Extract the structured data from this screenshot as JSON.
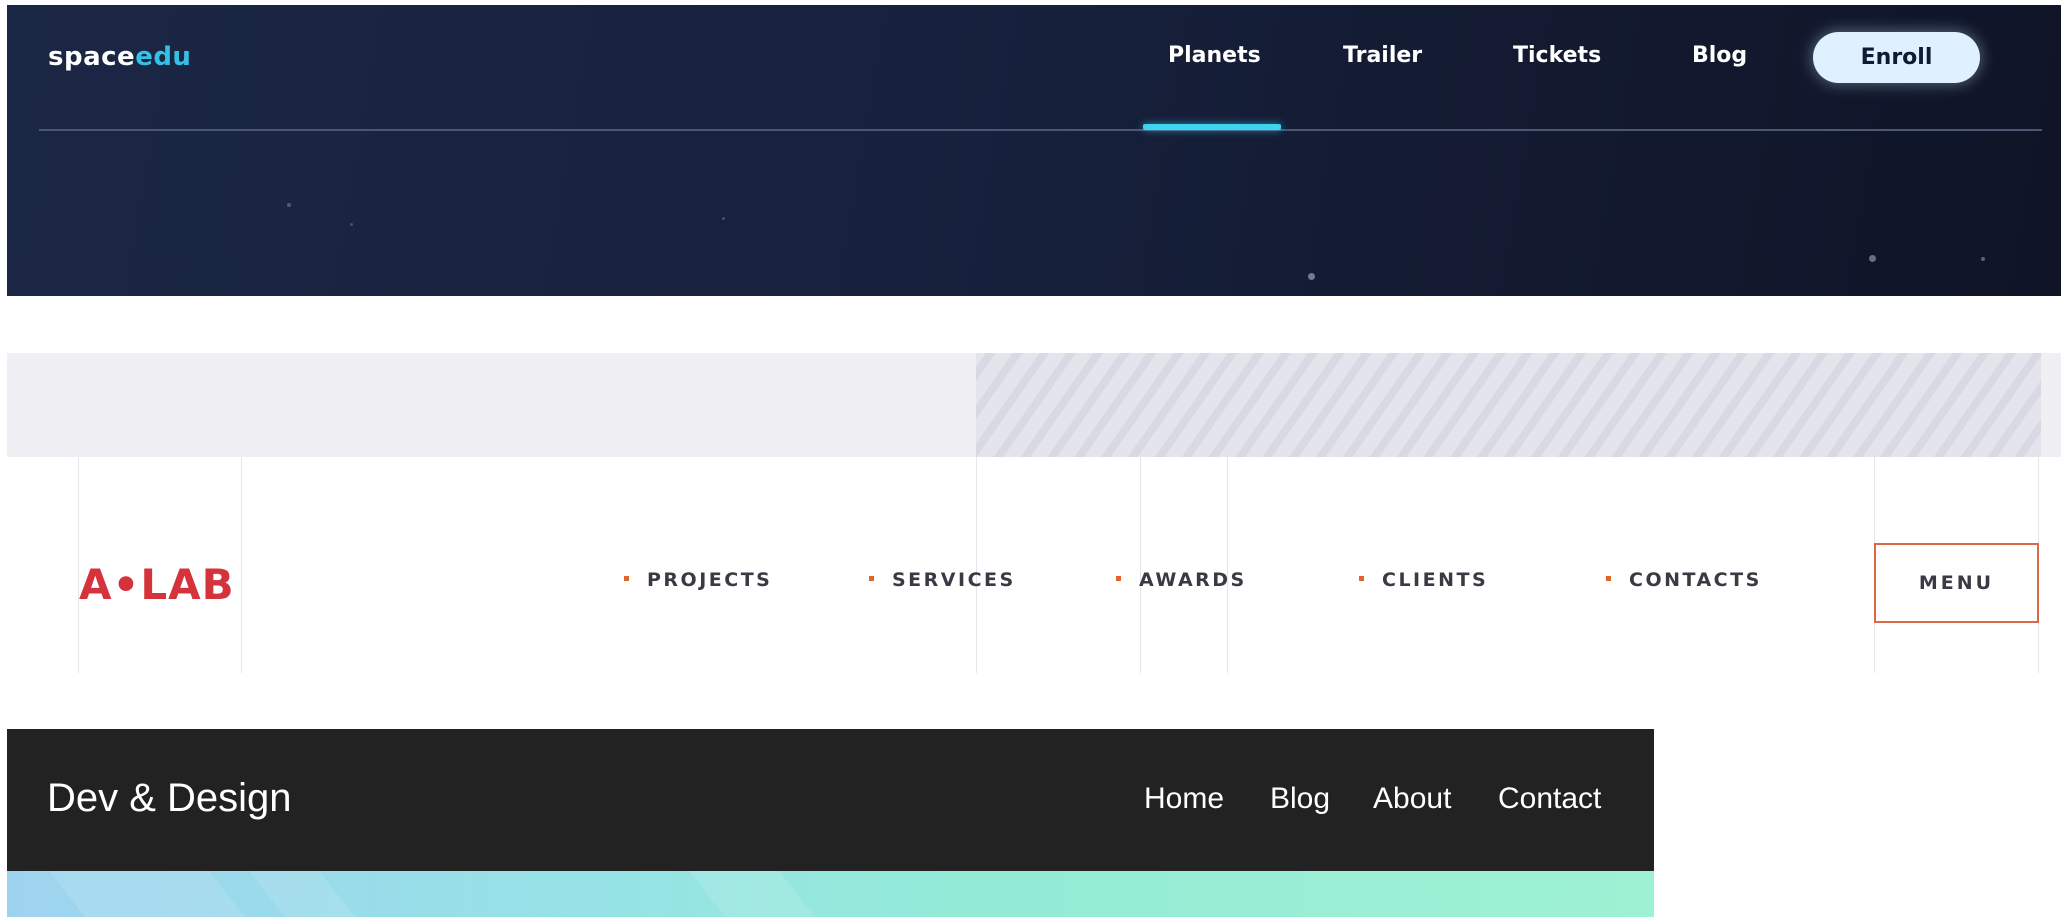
{
  "spaceedu": {
    "logo_main": "space",
    "logo_accent": "edu",
    "nav": {
      "planets": "Planets",
      "trailer": "Trailer",
      "tickets": "Tickets",
      "blog": "Blog"
    },
    "active_item": "Planets",
    "enroll_label": "Enroll",
    "colors": {
      "background": "#17213d",
      "accent": "#3fd3f2",
      "button": "#dff0ff"
    }
  },
  "alab": {
    "logo": "A•LAB",
    "nav": {
      "projects": "PROJECTS",
      "services": "SERVICES",
      "awards": "AWARDS",
      "clients": "CLIENTS",
      "contacts": "CONTACTS"
    },
    "menu_label": "MENU",
    "colors": {
      "logo": "#d4333c",
      "bullet": "#e0642e",
      "menu_border": "#d96a45"
    }
  },
  "devdesign": {
    "brand": "Dev & Design",
    "nav": {
      "home": "Home",
      "blog": "Blog",
      "about": "About",
      "contact": "Contact"
    },
    "colors": {
      "header": "#222222",
      "hero_start": "#9ed3ef",
      "hero_end": "#9ef1d3"
    }
  }
}
